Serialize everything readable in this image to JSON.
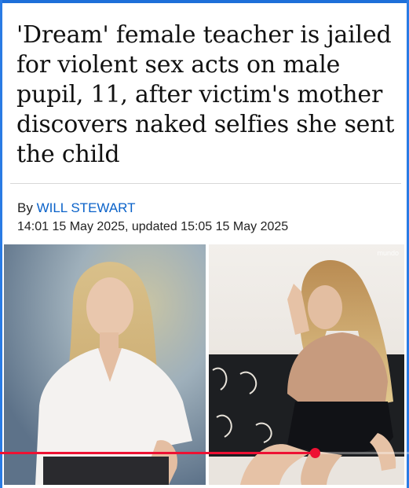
{
  "article": {
    "headline": "'Dream' female teacher is jailed for violent sex acts on male pupil, 11, after victim's mother discovers naked selfies she sent the child",
    "byline_prefix": "By",
    "author": "WILL STEWART",
    "timestamp": "14:01 15 May 2025, updated 15:05 15 May 2025"
  },
  "photos": {
    "right_watermark": "mundo"
  },
  "video": {
    "progress_fraction": 0.77,
    "progress_color": "#ee1133"
  },
  "colors": {
    "accent_frame": "#1e6fd9",
    "author_link": "#0a62c9"
  }
}
